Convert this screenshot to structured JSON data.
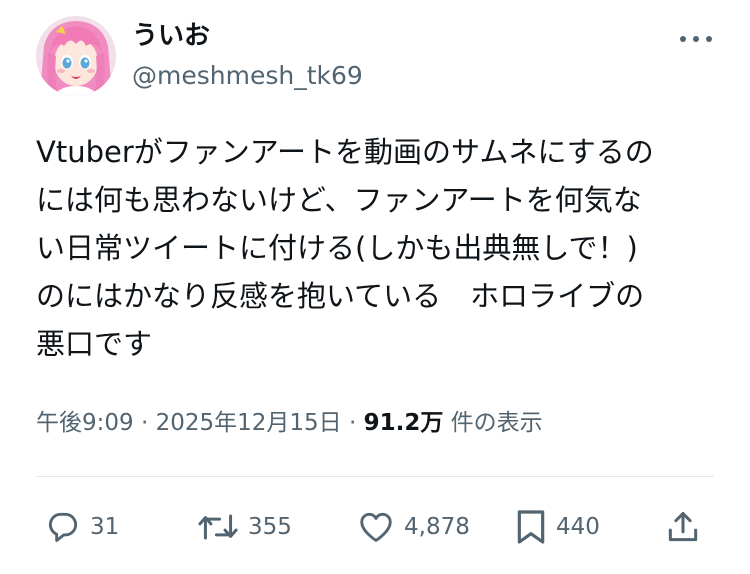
{
  "author": {
    "display_name": "ういお",
    "handle": "@meshmesh_tk69"
  },
  "tweet": {
    "lines": [
      "Vtuberがファンアートを動画のサムネにするの",
      "には何も思わないけど、ファンアートを何気な",
      "い日常ツイートに付ける(しかも出典無しで！)",
      "のにはかなり反感を抱いている　ホロライブの",
      "悪口です"
    ]
  },
  "meta": {
    "time": "午後9:09",
    "separator1": " · ",
    "date": "2025年12月15日",
    "separator2": " · ",
    "views": "91.2万",
    "views_label": " 件の表示"
  },
  "actions": {
    "replies": "31",
    "reposts": "355",
    "likes": "4,878",
    "bookmarks": "440"
  },
  "icons": {
    "more": "more-horizontal-icon",
    "reply": "speech-bubble-icon",
    "repost": "repost-arrows-icon",
    "like": "heart-icon",
    "bookmark": "bookmark-icon",
    "share": "share-upload-icon"
  },
  "colors": {
    "text": "#0f1419",
    "secondary": "#536471",
    "divider": "#e6e9eb"
  }
}
